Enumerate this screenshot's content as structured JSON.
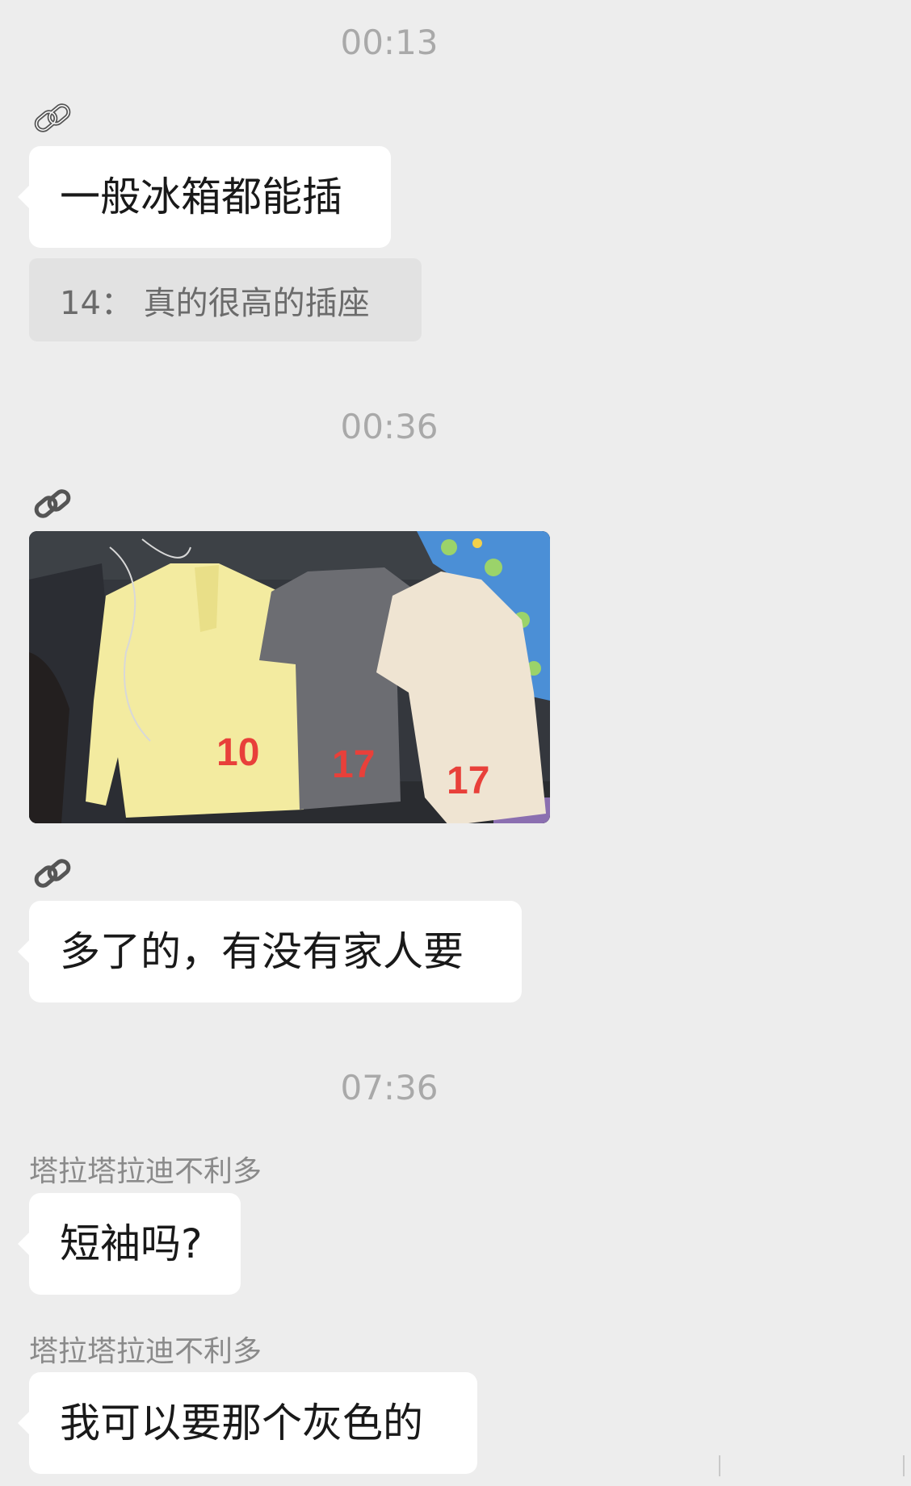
{
  "messages": {
    "time1": "00:13",
    "msg1": "一般冰箱都能插",
    "quote1": "14：  真的很高的插座",
    "time2": "00:36",
    "photo": {
      "label_yellow": "10",
      "label_gray": "17",
      "label_cream": "17"
    },
    "msg2": "多了的，有没有家人要",
    "time3": "07:36",
    "sender1": "塔拉塔拉迪不利多",
    "msg3": "短袖吗?",
    "sender2": "塔拉塔拉迪不利多",
    "msg4": "我可以要那个灰色的"
  },
  "icons": {
    "link": "link-icon"
  },
  "colors": {
    "background": "#ededed",
    "bubble": "#ffffff",
    "quote_bg": "#e2e2e2",
    "timestamp": "#a9a9a9",
    "photo_label": "#e8403a"
  }
}
